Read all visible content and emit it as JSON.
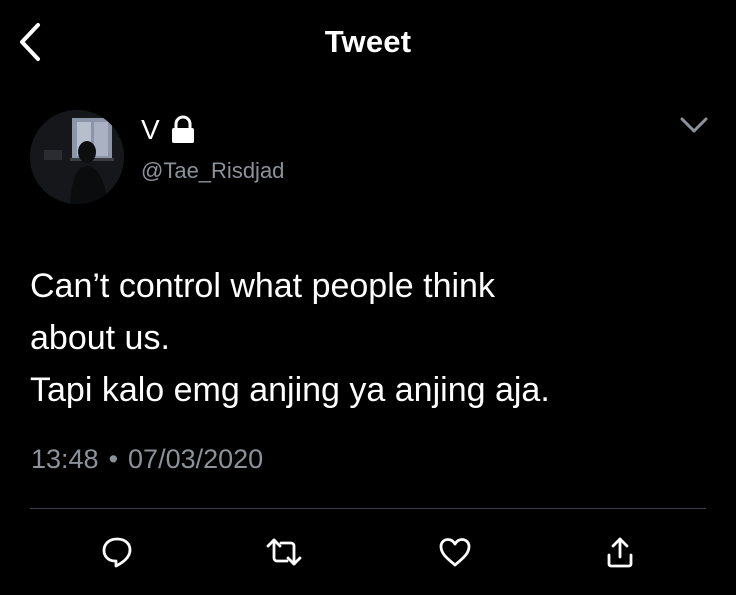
{
  "header": {
    "title": "Tweet",
    "back_icon": "chevron-left-icon"
  },
  "author": {
    "display_name": "V",
    "handle": "@Tae_Risdjad",
    "protected_icon": "lock-icon",
    "avatar": "profile-photo"
  },
  "tweet": {
    "lines": [
      "Can’t control what people think",
      "about us.",
      "Tapi kalo emg anjing ya anjing aja."
    ],
    "time": "13:48",
    "separator": "•",
    "date": "07/03/2020"
  },
  "actions": {
    "reply_icon": "reply-icon",
    "retweet_icon": "retweet-icon",
    "like_icon": "heart-icon",
    "share_icon": "share-icon"
  },
  "colors": {
    "background": "#000000",
    "text": "#ffffff",
    "secondary_text": "#8b9299",
    "divider": "#3a3e44"
  }
}
